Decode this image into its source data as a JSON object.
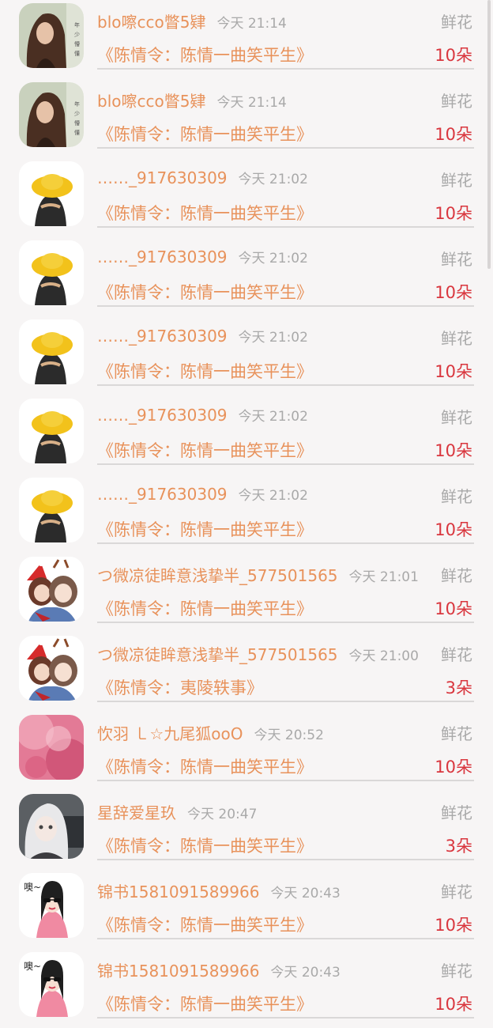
{
  "gift_label": "鲜花",
  "items": [
    {
      "avatar": "avatar-girl-long-hair",
      "name": "blo嚓cco瞥5肄",
      "time": "今天 21:14",
      "work": "《陈情令：陈情一曲笑平生》",
      "count": "10朵"
    },
    {
      "avatar": "avatar-girl-long-hair",
      "name": "blo嚓cco瞥5肄",
      "time": "今天 21:14",
      "work": "《陈情令：陈情一曲笑平生》",
      "count": "10朵"
    },
    {
      "avatar": "avatar-yellow-hat",
      "name": "……_917630309",
      "time": "今天 21:02",
      "work": "《陈情令：陈情一曲笑平生》",
      "count": "10朵"
    },
    {
      "avatar": "avatar-yellow-hat",
      "name": "……_917630309",
      "time": "今天 21:02",
      "work": "《陈情令：陈情一曲笑平生》",
      "count": "10朵"
    },
    {
      "avatar": "avatar-yellow-hat",
      "name": "……_917630309",
      "time": "今天 21:02",
      "work": "《陈情令：陈情一曲笑平生》",
      "count": "10朵"
    },
    {
      "avatar": "avatar-yellow-hat",
      "name": "……_917630309",
      "time": "今天 21:02",
      "work": "《陈情令：陈情一曲笑平生》",
      "count": "10朵"
    },
    {
      "avatar": "avatar-yellow-hat",
      "name": "……_917630309",
      "time": "今天 21:02",
      "work": "《陈情令：陈情一曲笑平生》",
      "count": "10朵"
    },
    {
      "avatar": "avatar-christmas-pair",
      "name": "つ微凉徒眸意浅挚半_577501565",
      "time": "今天 21:01",
      "work": "《陈情令：陈情一曲笑平生》",
      "count": "10朵"
    },
    {
      "avatar": "avatar-christmas-pair",
      "name": "つ微凉徒眸意浅挚半_577501565",
      "time": "今天 21:00",
      "work": "《陈情令：夷陵轶事》",
      "count": "3朵"
    },
    {
      "avatar": "avatar-pink-blur",
      "name": "忺羽 ㇄☆九尾狐ooO",
      "time": "今天 20:52",
      "work": "《陈情令：陈情一曲笑平生》",
      "count": "10朵"
    },
    {
      "avatar": "avatar-anime-silver",
      "name": "星辞爱星玖",
      "time": "今天 20:47",
      "work": "《陈情令：陈情一曲笑平生》",
      "count": "3朵"
    },
    {
      "avatar": "avatar-sunglasses-girl",
      "name": "锦书1581091589966",
      "time": "今天 20:43",
      "work": "《陈情令：陈情一曲笑平生》",
      "count": "10朵"
    },
    {
      "avatar": "avatar-sunglasses-girl",
      "name": "锦书1581091589966",
      "time": "今天 20:43",
      "work": "《陈情令：陈情一曲笑平生》",
      "count": "10朵"
    }
  ]
}
